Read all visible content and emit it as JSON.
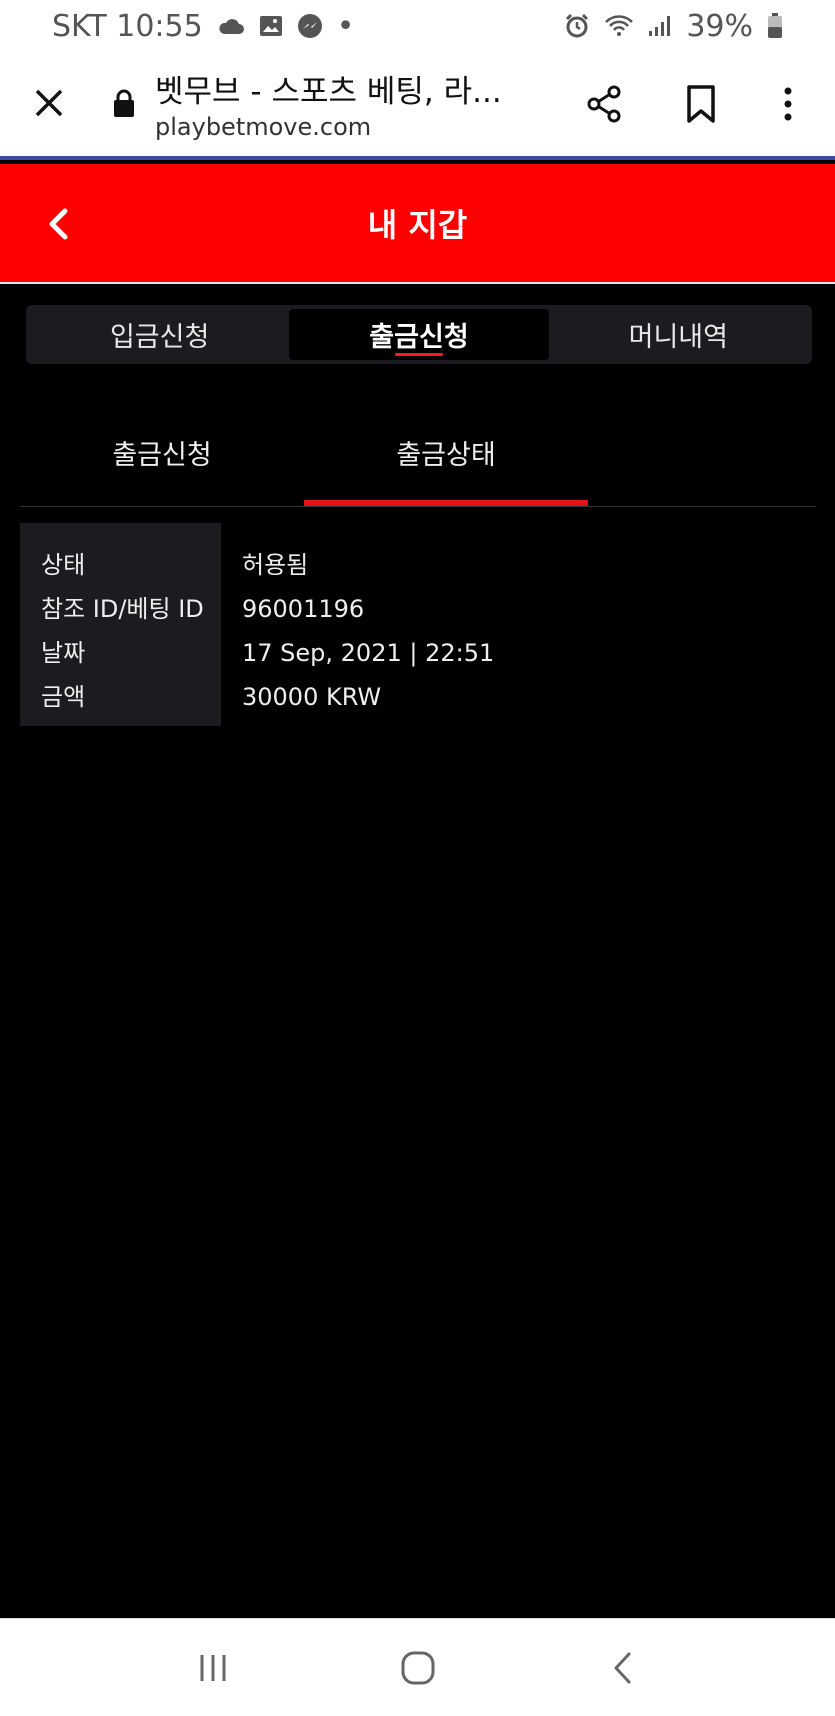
{
  "status_bar": {
    "carrier_time": "SKT 10:55",
    "dot": "•",
    "battery": "39%"
  },
  "browser": {
    "page_title": "벳무브 - 스포츠 베팅, 라...",
    "url": "playbetmove.com"
  },
  "header": {
    "title": "내 지갑"
  },
  "wallet_tabs": [
    {
      "label": "입금신청",
      "active": false
    },
    {
      "label": "출금신청",
      "active": true
    },
    {
      "label": "머니내역",
      "active": false
    }
  ],
  "sub_tabs": [
    {
      "label": "출금신청",
      "active": false
    },
    {
      "label": "출금상태",
      "active": true
    }
  ],
  "withdraw_status": {
    "rows": [
      {
        "label": "상태",
        "value": "허용됨"
      },
      {
        "label": "참조 ID/베팅 ID",
        "value": "96001196"
      },
      {
        "label": "날짜",
        "value": "17 Sep, 2021 | 22:51"
      },
      {
        "label": "금액",
        "value": "30000 KRW"
      }
    ]
  },
  "colors": {
    "header_red": "#ff0000",
    "accent_red": "#e0141a",
    "panel_dark": "#1c1c20",
    "background": "#000000"
  }
}
